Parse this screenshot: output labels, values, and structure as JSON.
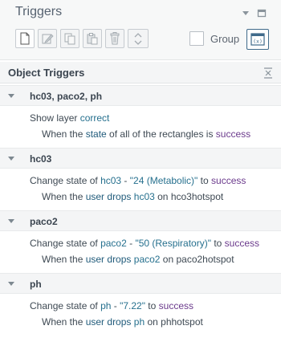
{
  "panel": {
    "title": "Triggers"
  },
  "toolbar": {
    "group_label": "Group"
  },
  "section": {
    "title": "Object Triggers"
  },
  "triggers": [
    {
      "name": "hc03, paco2, ph",
      "action": {
        "p1": "Show layer ",
        "p2": "correct"
      },
      "condition": {
        "p1": "When the ",
        "p2": "state",
        "p3": " of all of the rectangles is ",
        "p4": "success"
      }
    },
    {
      "name": "hc03",
      "action": {
        "p1": "Change state of ",
        "p2": "hc03",
        "p3": " - ",
        "p4": "\"24 (Metabolic)\"",
        "p5": " to ",
        "p6": "success"
      },
      "condition": {
        "p1": "When the ",
        "p2": "user",
        "p3": " ",
        "p4": "drops",
        "p5": " ",
        "p6": "hc03",
        "p7": " on hco3hotspot"
      }
    },
    {
      "name": "paco2",
      "action": {
        "p1": "Change state of ",
        "p2": "paco2",
        "p3": " - ",
        "p4": "\"50 (Respiratory)\"",
        "p5": " to ",
        "p6": "success"
      },
      "condition": {
        "p1": "When the ",
        "p2": "user",
        "p3": " ",
        "p4": "drops",
        "p5": " ",
        "p6": "paco2",
        "p7": " on paco2hotspot"
      }
    },
    {
      "name": "ph",
      "action": {
        "p1": "Change state of ",
        "p2": "ph",
        "p3": " - ",
        "p4": "\"7.22\"",
        "p5": " to ",
        "p6": "success"
      },
      "condition": {
        "p1": "When the ",
        "p2": "user",
        "p3": " ",
        "p4": "drops",
        "p5": " ",
        "p6": "ph",
        "p7": " on phhotspot"
      }
    }
  ]
}
